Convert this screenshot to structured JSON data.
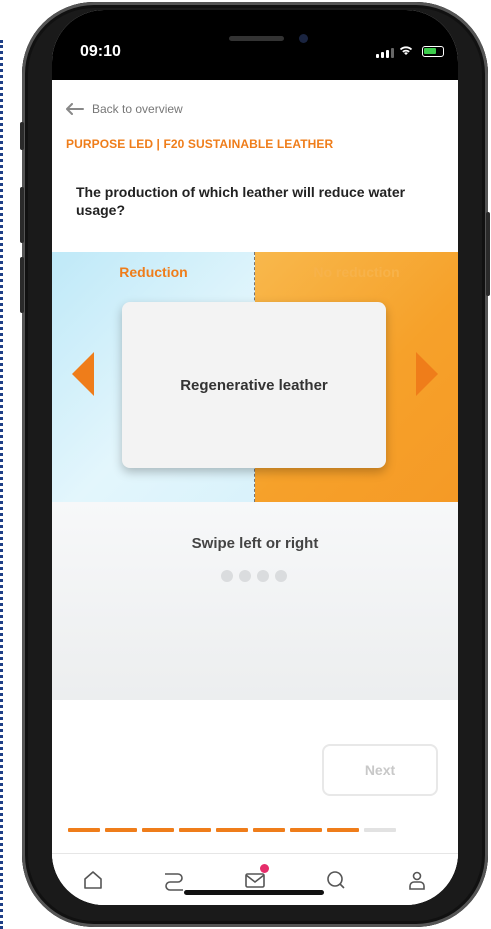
{
  "status_bar": {
    "time": "09:10"
  },
  "nav": {
    "back_label": "Back to overview"
  },
  "module": {
    "kicker": "PURPOSE LED | F20 SUSTAINABLE LEATHER"
  },
  "question": {
    "text": "The production of which leather will reduce water usage?"
  },
  "swipe": {
    "left_label": "Reduction",
    "right_label": "No reduction",
    "card_text": "Regenerative leather",
    "hint": "Swipe left or right",
    "pager_count": 4
  },
  "actions": {
    "next_label": "Next"
  },
  "progress": {
    "total_segments": 9,
    "completed_segments": 8
  },
  "tabbar": {
    "items": [
      "home-icon",
      "path-icon",
      "mail-icon",
      "search-icon",
      "profile-icon"
    ],
    "mail_has_badge": true
  },
  "colors": {
    "accent": "#ef7d1a",
    "accent_light": "#f7b24a",
    "badge": "#e52d6a",
    "progress_inactive": "#e2e2e2"
  }
}
